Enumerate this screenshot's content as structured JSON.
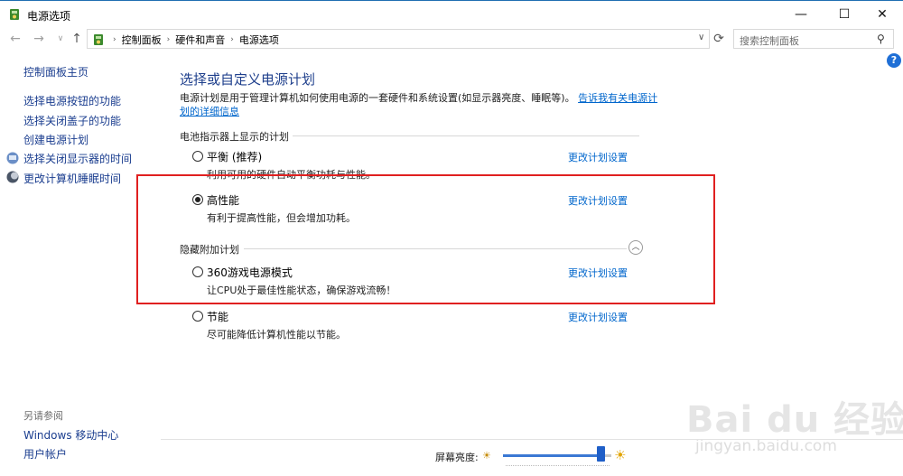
{
  "window": {
    "title": "电源选项",
    "min_glyph": "—",
    "max_glyph": "☐",
    "close_glyph": "✕"
  },
  "navigation": {
    "back_glyph": "←",
    "forward_glyph": "→",
    "history_glyph": "∨",
    "up_glyph": "↑",
    "breadcrumb": [
      "控制面板",
      "硬件和声音",
      "电源选项"
    ],
    "separator": "›",
    "dropdown_glyph": "∨",
    "refresh_glyph": "⟳",
    "search_placeholder": "搜索控制面板",
    "search_glyph": "⚲"
  },
  "help_glyph": "?",
  "sidebar": {
    "home": "控制面板主页",
    "links": [
      "选择电源按钮的功能",
      "选择关闭盖子的功能",
      "创建电源计划",
      "选择关闭显示器的时间",
      "更改计算机睡眠时间"
    ],
    "see_also_title": "另请参阅",
    "see_also": [
      "Windows 移动中心",
      "用户帐户"
    ]
  },
  "main": {
    "title": "选择或自定义电源计划",
    "description": "电源计划是用于管理计算机如何使用电源的一套硬件和系统设置(如显示器亮度、睡眠等)。",
    "learn_more": "告诉我有关电源计划的详细信息",
    "battery_group": "电池指示器上显示的计划",
    "hidden_group": "隐藏附加计划",
    "collapse_glyph": "︿",
    "plans": [
      {
        "name": "平衡 (推荐)",
        "desc": "利用可用的硬件自动平衡功耗与性能。",
        "link": "更改计划设置",
        "selected": false
      },
      {
        "name": "高性能",
        "desc": "有利于提高性能，但会增加功耗。",
        "link": "更改计划设置",
        "selected": true
      },
      {
        "name": "360游戏电源模式",
        "desc": "让CPU处于最佳性能状态，确保游戏流畅！",
        "link": "更改计划设置",
        "selected": false
      },
      {
        "name": "节能",
        "desc": "尽可能降低计算机性能以节能。",
        "link": "更改计划设置",
        "selected": false
      }
    ]
  },
  "footer": {
    "brightness_label": "屏幕亮度:",
    "brightness_level": 0.9,
    "sun_low_glyph": "☀",
    "sun_high_glyph": "☀"
  },
  "watermark": {
    "text": "Bai du 经验",
    "sub": "jingyan.baidu.com"
  },
  "colors": {
    "link": "#0066cc",
    "sidebar_link": "#1a3d8f",
    "heading": "#1e3f8c",
    "highlight_box": "#e02020",
    "slider": "#1f5fc8"
  }
}
